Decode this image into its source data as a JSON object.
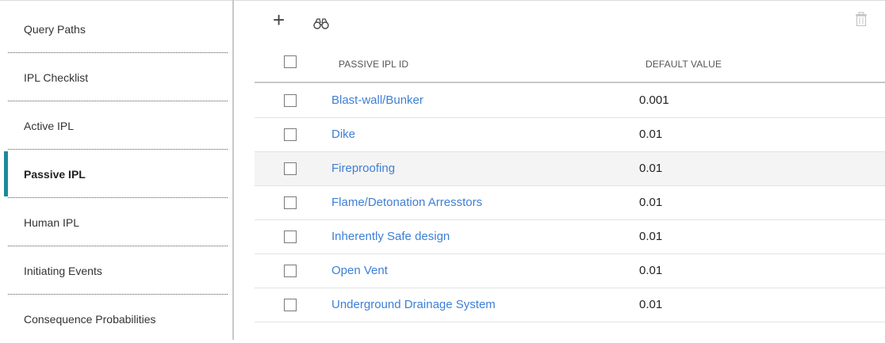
{
  "sidebar": {
    "items": [
      {
        "label": "Query Paths",
        "active": false
      },
      {
        "label": "IPL Checklist",
        "active": false
      },
      {
        "label": "Active IPL",
        "active": false
      },
      {
        "label": "Passive IPL",
        "active": true
      },
      {
        "label": "Human IPL",
        "active": false
      },
      {
        "label": "Initiating Events",
        "active": false
      },
      {
        "label": "Consequence Probabilities",
        "active": false
      }
    ],
    "accent_color": "#1b8a9a"
  },
  "toolbar": {
    "add_icon": "plus-icon",
    "find_icon": "binoculars-icon",
    "delete_icon": "trash-icon"
  },
  "table": {
    "columns": [
      "PASSIVE IPL ID",
      "DEFAULT VALUE"
    ],
    "rows": [
      {
        "id": "Blast-wall/Bunker",
        "value": "0.001"
      },
      {
        "id": "Dike",
        "value": "0.01"
      },
      {
        "id": "Fireproofing",
        "value": "0.01"
      },
      {
        "id": "Flame/Detonation Arresstors",
        "value": "0.01"
      },
      {
        "id": "Inherently Safe design",
        "value": "0.01"
      },
      {
        "id": "Open Vent",
        "value": "0.01"
      },
      {
        "id": "Underground Drainage System",
        "value": "0.01"
      }
    ],
    "link_color": "#3d7fd6"
  }
}
